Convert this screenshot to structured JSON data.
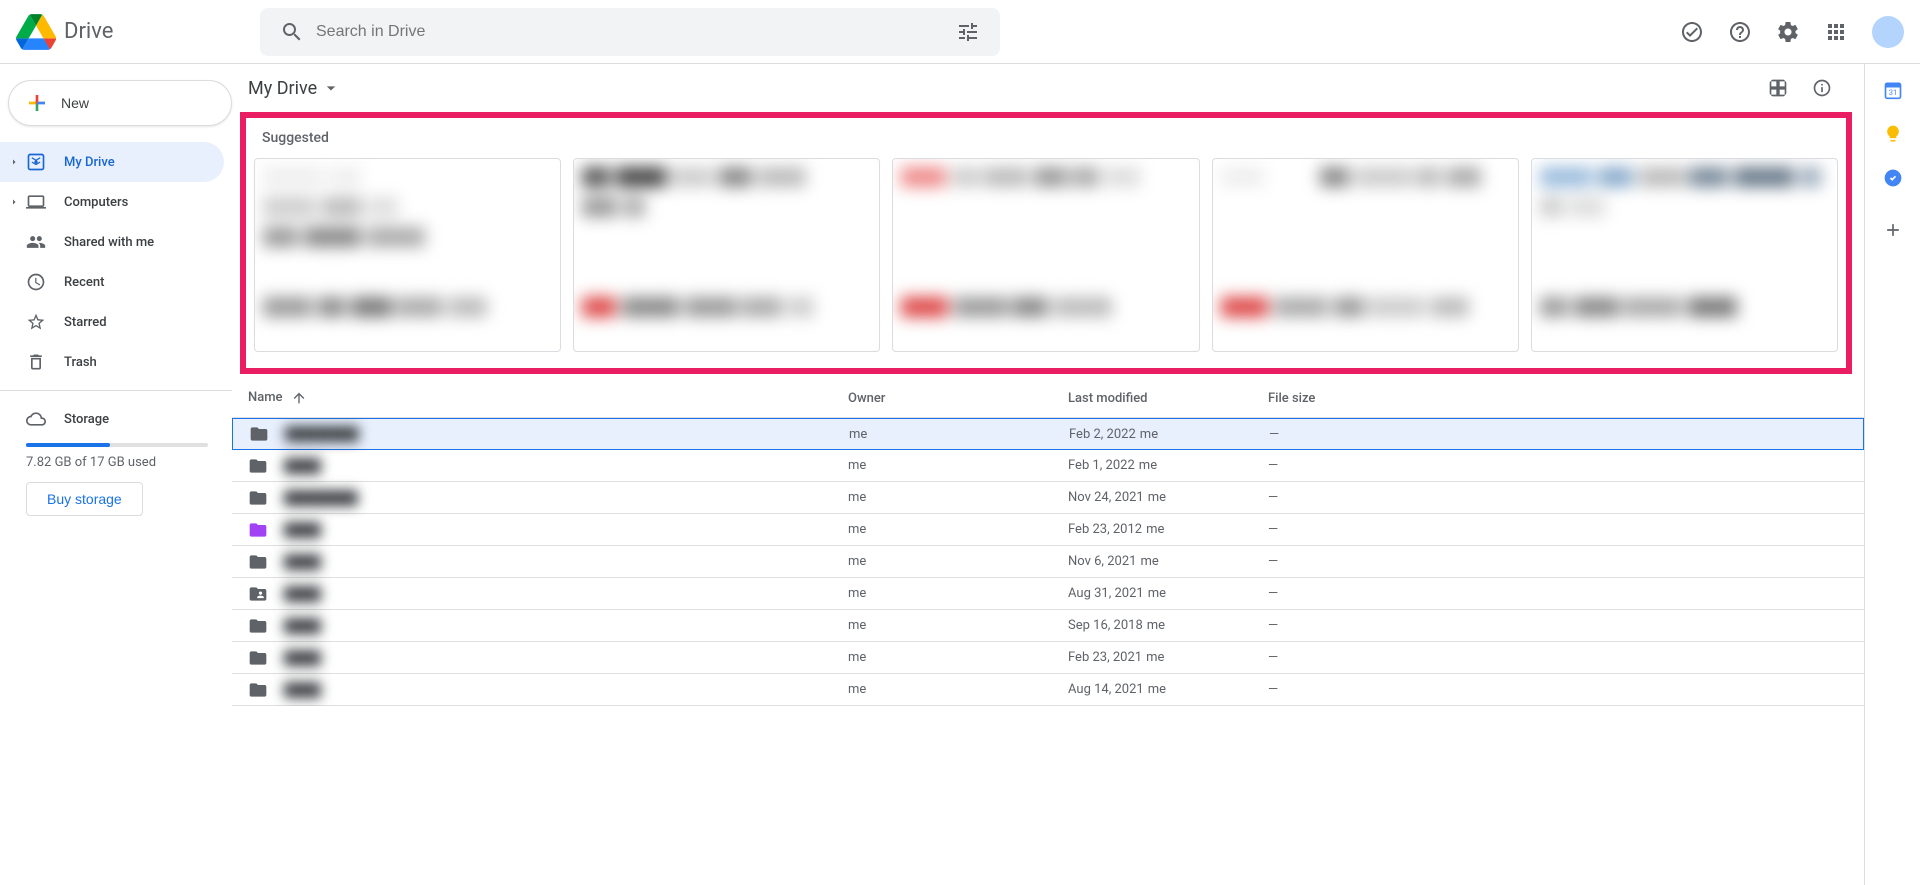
{
  "app": {
    "name": "Drive"
  },
  "search": {
    "placeholder": "Search in Drive"
  },
  "newButton": {
    "label": "New"
  },
  "sidebar": {
    "items": [
      {
        "label": "My Drive",
        "icon": "drive",
        "active": true,
        "expandable": true
      },
      {
        "label": "Computers",
        "icon": "computer",
        "active": false,
        "expandable": true
      },
      {
        "label": "Shared with me",
        "icon": "shared",
        "active": false,
        "expandable": false
      },
      {
        "label": "Recent",
        "icon": "recent",
        "active": false,
        "expandable": false
      },
      {
        "label": "Starred",
        "icon": "star",
        "active": false,
        "expandable": false
      },
      {
        "label": "Trash",
        "icon": "trash",
        "active": false,
        "expandable": false
      }
    ],
    "storage": {
      "label": "Storage",
      "used_text": "7.82 GB of 17 GB used",
      "percent": 46,
      "buy_label": "Buy storage"
    }
  },
  "breadcrumb": {
    "title": "My Drive"
  },
  "suggested": {
    "label": "Suggested"
  },
  "columns": {
    "name": "Name",
    "owner": "Owner",
    "modified": "Last modified",
    "size": "File size"
  },
  "files": [
    {
      "name": "████████",
      "owner": "me",
      "modified": "Feb 2, 2022",
      "modified_by": "me",
      "size": "—",
      "icon": "folder",
      "selected": true
    },
    {
      "name": "████",
      "owner": "me",
      "modified": "Feb 1, 2022",
      "modified_by": "me",
      "size": "—",
      "icon": "folder"
    },
    {
      "name": "████████",
      "owner": "me",
      "modified": "Nov 24, 2021",
      "modified_by": "me",
      "size": "—",
      "icon": "folder"
    },
    {
      "name": "████",
      "owner": "me",
      "modified": "Feb 23, 2012",
      "modified_by": "me",
      "size": "—",
      "icon": "folder-purple"
    },
    {
      "name": "████",
      "owner": "me",
      "modified": "Nov 6, 2021",
      "modified_by": "me",
      "size": "—",
      "icon": "folder"
    },
    {
      "name": "████",
      "owner": "me",
      "modified": "Aug 31, 2021",
      "modified_by": "me",
      "size": "—",
      "icon": "folder-shared"
    },
    {
      "name": "████",
      "owner": "me",
      "modified": "Sep 16, 2018",
      "modified_by": "me",
      "size": "—",
      "icon": "folder"
    },
    {
      "name": "████",
      "owner": "me",
      "modified": "Feb 23, 2021",
      "modified_by": "me",
      "size": "—",
      "icon": "folder"
    },
    {
      "name": "████",
      "owner": "me",
      "modified": "Aug 14, 2021",
      "modified_by": "me",
      "size": "—",
      "icon": "folder"
    }
  ]
}
